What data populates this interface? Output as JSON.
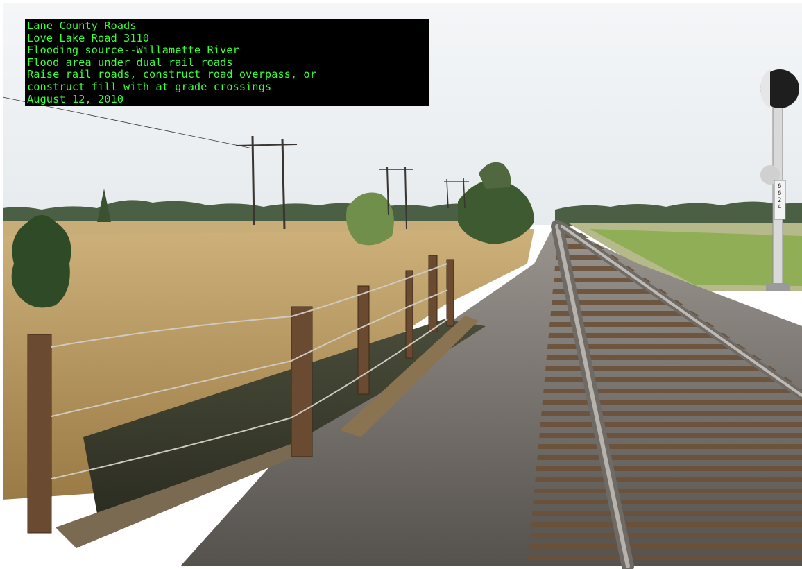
{
  "photo": {
    "subject": "Railroad tracks beside a ditch with a wire fence in a grassy flood area",
    "caption_lines": [
      "Lane County Roads",
      "Love Lake Road 3110",
      "Flooding source--Willamette River",
      "Flood area under dual rail roads",
      "Raise rail roads, construct road overpass, or",
      "construct fill with at grade crossings",
      "August 12, 2010"
    ],
    "signal_sign": "6624"
  },
  "colors": {
    "caption_background": "#000000",
    "caption_text": "#39ff3a",
    "sky": "#eef2f4",
    "dry_grass": "#c9a867",
    "ballast": "#6e6a66",
    "rail": "#8a8580",
    "ties": "#5a4430",
    "trees": "#3f5a33"
  }
}
